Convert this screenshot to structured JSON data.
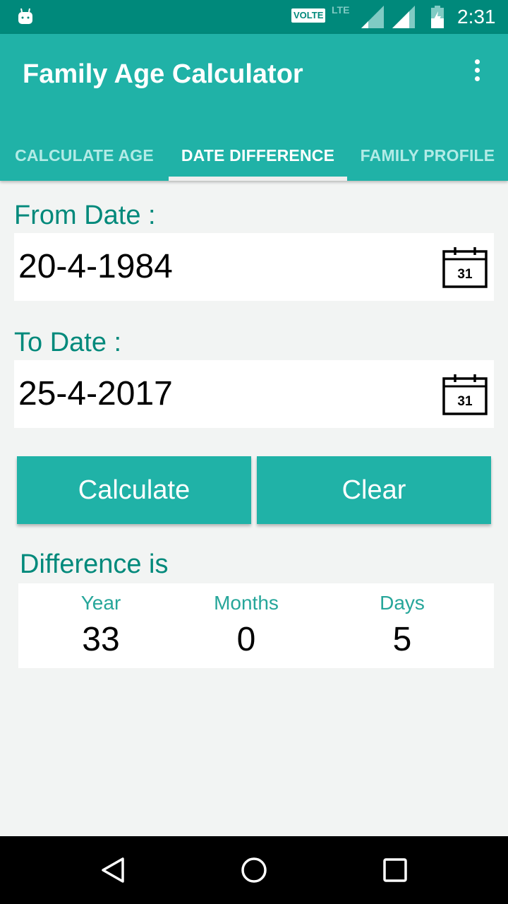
{
  "status_bar": {
    "volte": "VOLTE",
    "network": "LTE",
    "time": "2:31",
    "icons": [
      "android-icon",
      "volte-icon",
      "lte-icon",
      "signal-icon",
      "signal-icon",
      "battery-charging-icon"
    ]
  },
  "app_bar": {
    "title": "Family Age Calculator",
    "overflow_icon": "more-vert-icon"
  },
  "tabs": [
    {
      "label": "CALCULATE  AGE",
      "active": false
    },
    {
      "label": "DATE DIFFERENCE",
      "active": true
    },
    {
      "label": "FAMILY PROFILE",
      "active": false
    }
  ],
  "form": {
    "from_label": "From Date :",
    "from_value": "20-4-1984",
    "to_label": "To Date :",
    "to_value": "25-4-2017",
    "calendar_icon_text": "31"
  },
  "buttons": {
    "calculate": "Calculate",
    "clear": "Clear"
  },
  "result": {
    "label": "Difference is",
    "columns": [
      {
        "header": "Year",
        "value": "33"
      },
      {
        "header": "Months",
        "value": "0"
      },
      {
        "header": "Days",
        "value": "5"
      }
    ]
  },
  "colors": {
    "status_bar": "#00897b",
    "primary": "#20b2a7",
    "accent_text": "#00897b",
    "background": "#f2f4f3"
  }
}
